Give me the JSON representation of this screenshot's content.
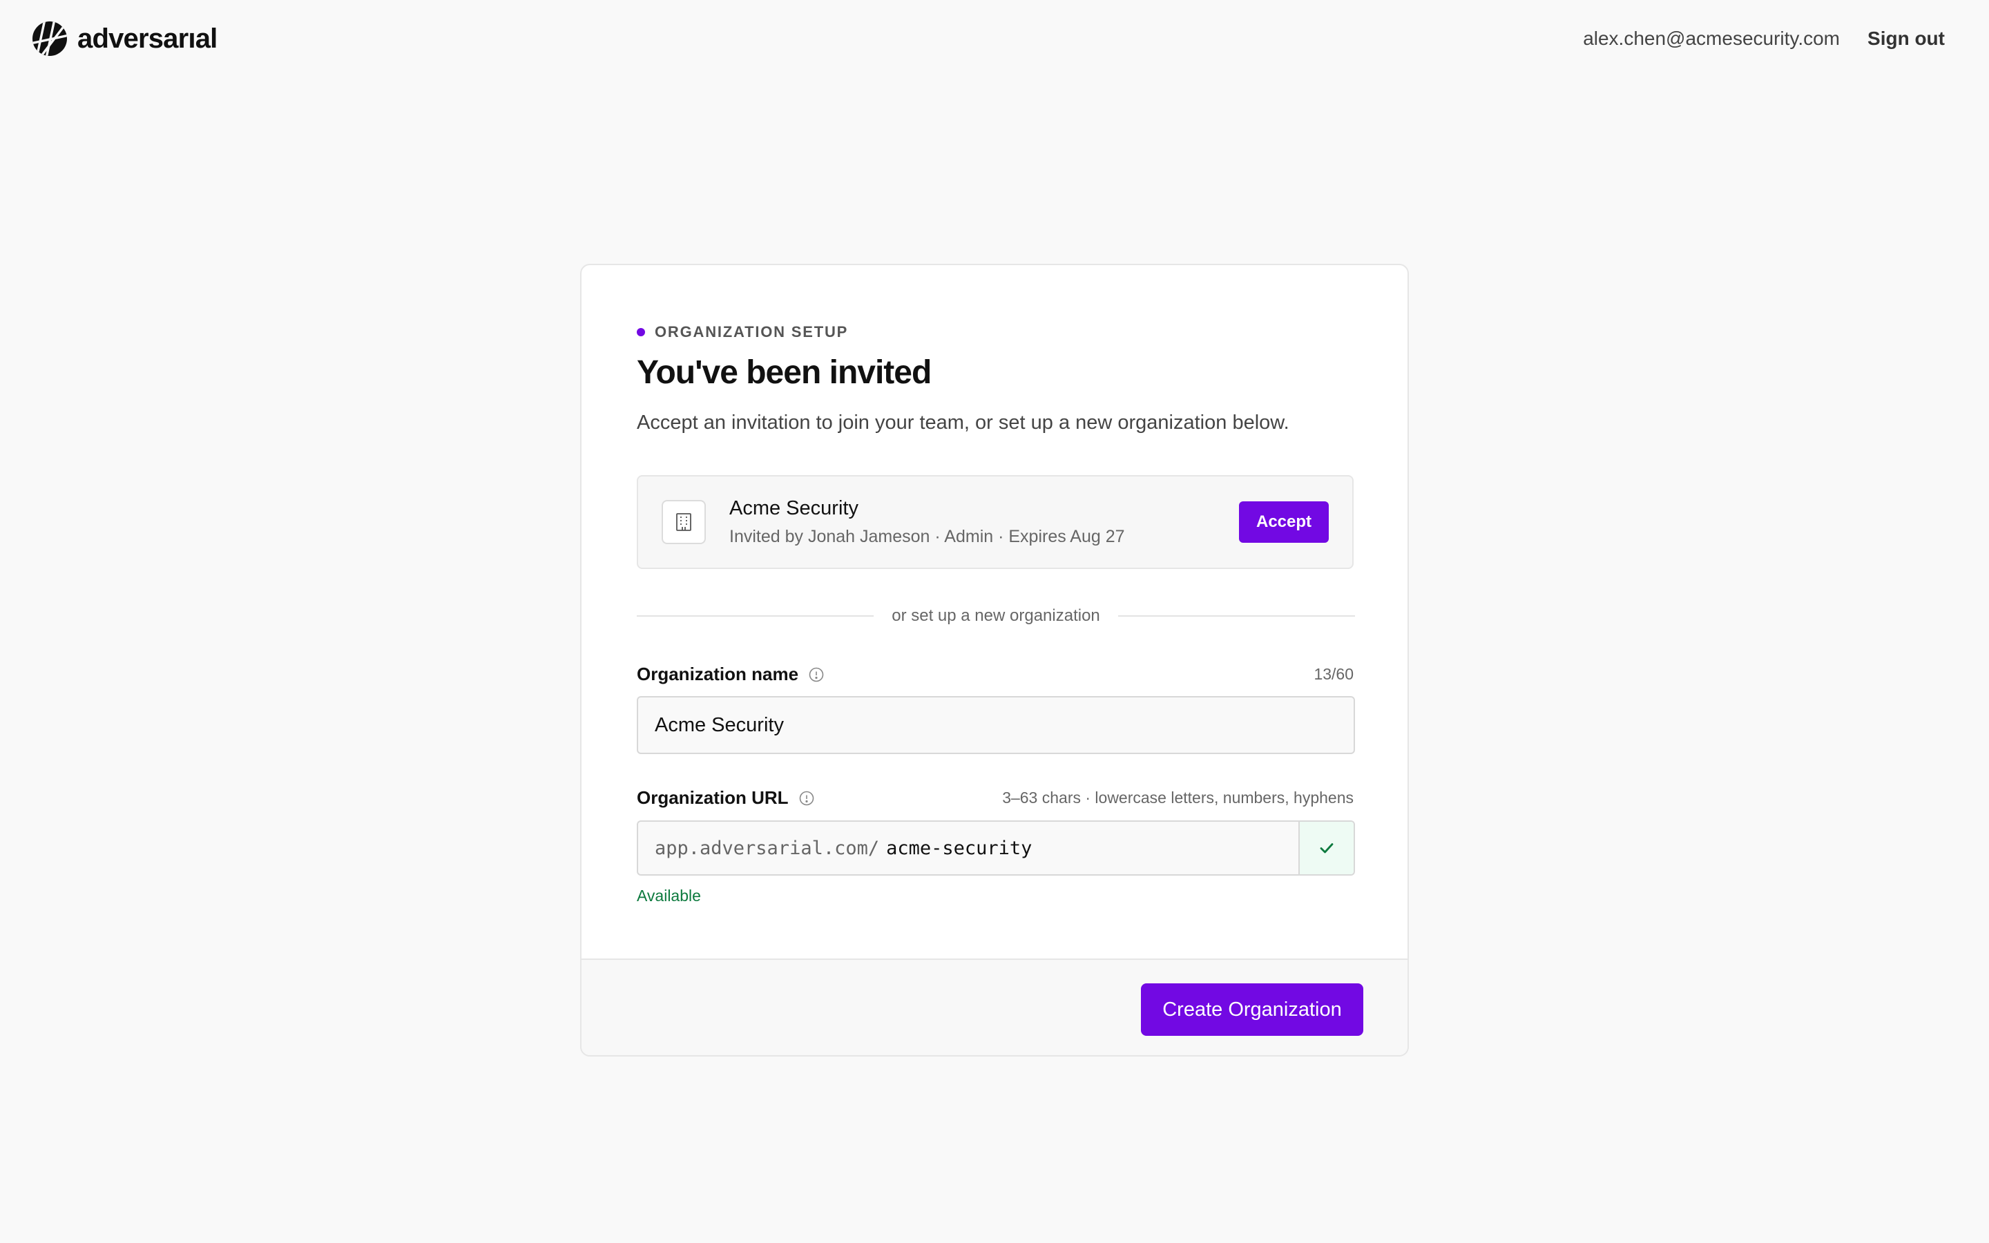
{
  "header": {
    "brand_name": "adversarıal",
    "user_email": "alex.chen@acmesecurity.com",
    "sign_out_label": "Sign out"
  },
  "card": {
    "eyebrow": "ORGANIZATION SETUP",
    "title": "You've been invited",
    "subtitle": "Accept an invitation to join your team, or set up a new organization below.",
    "invitation": {
      "org_name": "Acme Security",
      "meta": "Invited by Jonah Jameson · Admin · Expires Aug 27",
      "accept_label": "Accept",
      "icon": "building-icon"
    },
    "divider_text": "or set up a new organization",
    "org_name_field": {
      "label": "Organization name",
      "counter": "13/60",
      "value": "Acme Security"
    },
    "org_url_field": {
      "label": "Organization URL",
      "hint": "3–63 chars · lowercase letters, numbers, hyphens",
      "prefix": "app.adversarial.com/",
      "value": "acme-security",
      "status": "Available",
      "status_icon": "check-icon"
    },
    "create_label": "Create Organization"
  },
  "colors": {
    "accent": "#7209e3",
    "success": "#0d7a3e",
    "success_bg": "#eefbf4",
    "background": "#f9f9f9"
  }
}
